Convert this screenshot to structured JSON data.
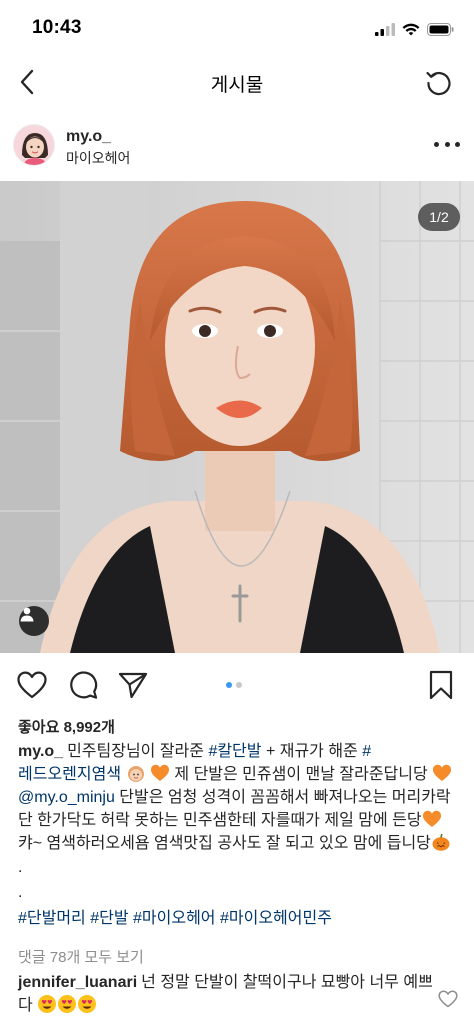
{
  "status_bar": {
    "time": "10:43",
    "icons": [
      "cellular-signal-icon",
      "wifi-icon",
      "battery-icon"
    ]
  },
  "nav": {
    "back_icon": "chevron-left-icon",
    "title": "게시물",
    "refresh_icon": "refresh-icon"
  },
  "post": {
    "username": "my.o_",
    "location": "마이오헤어",
    "more_icon": "more-horizontal-icon",
    "photo": {
      "page_indicator": "1/2",
      "tag_icon": "person-tag-icon"
    },
    "actions": {
      "like_icon": "heart-icon",
      "comment_icon": "comment-icon",
      "share_icon": "send-icon",
      "save_icon": "bookmark-icon"
    },
    "carousel": {
      "count": 2,
      "active": 1
    },
    "likes": "좋아요 8,992개",
    "caption": {
      "username": "my.o_",
      "text_1": "민주팀장님이 잘라준 ",
      "tag_1": "#칼단발",
      "text_2": " + 재규가 해준 ",
      "tag_2": "#레드오렌지염색",
      "text_3": " 제 단발은 민쥬샘이 맨날 잘라준답니당 ",
      "mention": "@my.o_minju",
      "text_4": "  단발은 엄청 성격이 꼼꼼해서 빠져나오는 머리카락 단 한가닥도 허락 못하는 민주샘한테 자를때가 제일 맘에 든당",
      "text_5": " 캬~ 염색하러오세욤 염색맛집  공사도 잘 되고 있오 맘에 듭니당",
      "dot_1": ".",
      "dot_2": ".",
      "hashtags": [
        "#단발머리",
        "#단발",
        "#마이오헤어",
        "#마이오헤어민주"
      ]
    },
    "view_comments": "댓글 78개 모두 보기",
    "comment": {
      "username": "jennifer_luanari",
      "text": "넌 정말 단발이 찰떡이구나 묘빵아 너무 예쁘다"
    },
    "colors": {
      "hashtag": "#003569",
      "carousel_active": "#3897f0",
      "muted": "#8e8e8e",
      "hair": "#c96a3a"
    }
  }
}
